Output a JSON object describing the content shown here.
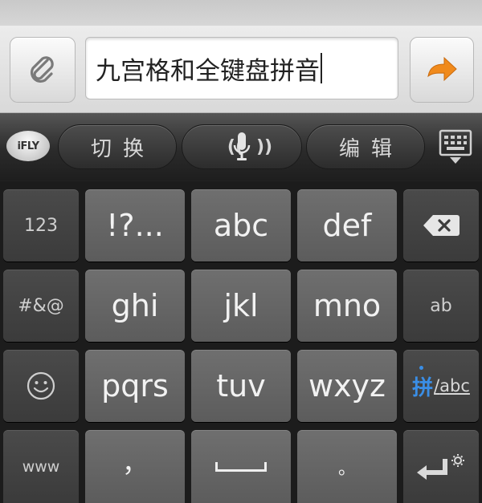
{
  "compose": {
    "text": "九宫格和全键盘拼音",
    "attach_icon": "paperclip-icon",
    "send_icon": "arrow-right-icon",
    "send_color": "#f08a1c"
  },
  "toolbar": {
    "logo_text": "iFLY",
    "switch_label": "切换",
    "voice_icon": "microphone-icon",
    "edit_label": "编辑",
    "hide_icon": "keyboard-hide-icon"
  },
  "keyboard": {
    "row1": {
      "side_left": "123",
      "k1": "!?...",
      "k2": "abc",
      "k3": "def",
      "side_right_icon": "backspace-icon"
    },
    "row2": {
      "side_left": "#&@",
      "k1": "ghi",
      "k2": "jkl",
      "k3": "mno",
      "side_right": "ab"
    },
    "row3": {
      "side_left_icon": "smiley-icon",
      "k1": "pqrs",
      "k2": "tuv",
      "k3": "wxyz",
      "mode_pinyin": "拼",
      "mode_abc": "abc"
    },
    "row4": {
      "side_left": "www",
      "comma": "，",
      "space_icon": "space-icon",
      "period": "。",
      "side_right_icon": "enter-gear-icon"
    }
  }
}
